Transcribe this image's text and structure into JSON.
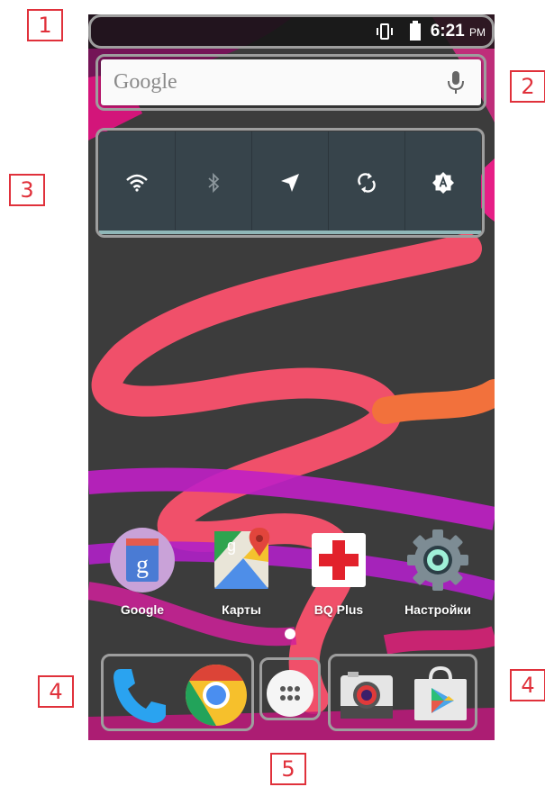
{
  "callouts": [
    "1",
    "2",
    "3",
    "4",
    "4",
    "5"
  ],
  "status_bar": {
    "time": "6:21",
    "ampm": "PM",
    "icons": [
      "vibrate-icon",
      "battery-icon"
    ]
  },
  "search": {
    "placeholder": "Google",
    "icon": "mic-icon"
  },
  "quick_settings": [
    "wifi-icon",
    "bluetooth-icon",
    "location-icon",
    "sync-icon",
    "auto-brightness-icon"
  ],
  "apps": [
    {
      "label": "Google",
      "icon": "google-folder-icon"
    },
    {
      "label": "Карты",
      "icon": "maps-icon"
    },
    {
      "label": "BQ Plus",
      "icon": "bq-plus-icon"
    },
    {
      "label": "Настройки",
      "icon": "settings-icon"
    }
  ],
  "dock": [
    "phone-icon",
    "chrome-icon",
    "app-drawer-icon",
    "camera-icon",
    "play-store-icon"
  ],
  "colors": {
    "accent": "#e0313b",
    "panel": "#37444b",
    "wallpaper": "#3b3b3b"
  }
}
